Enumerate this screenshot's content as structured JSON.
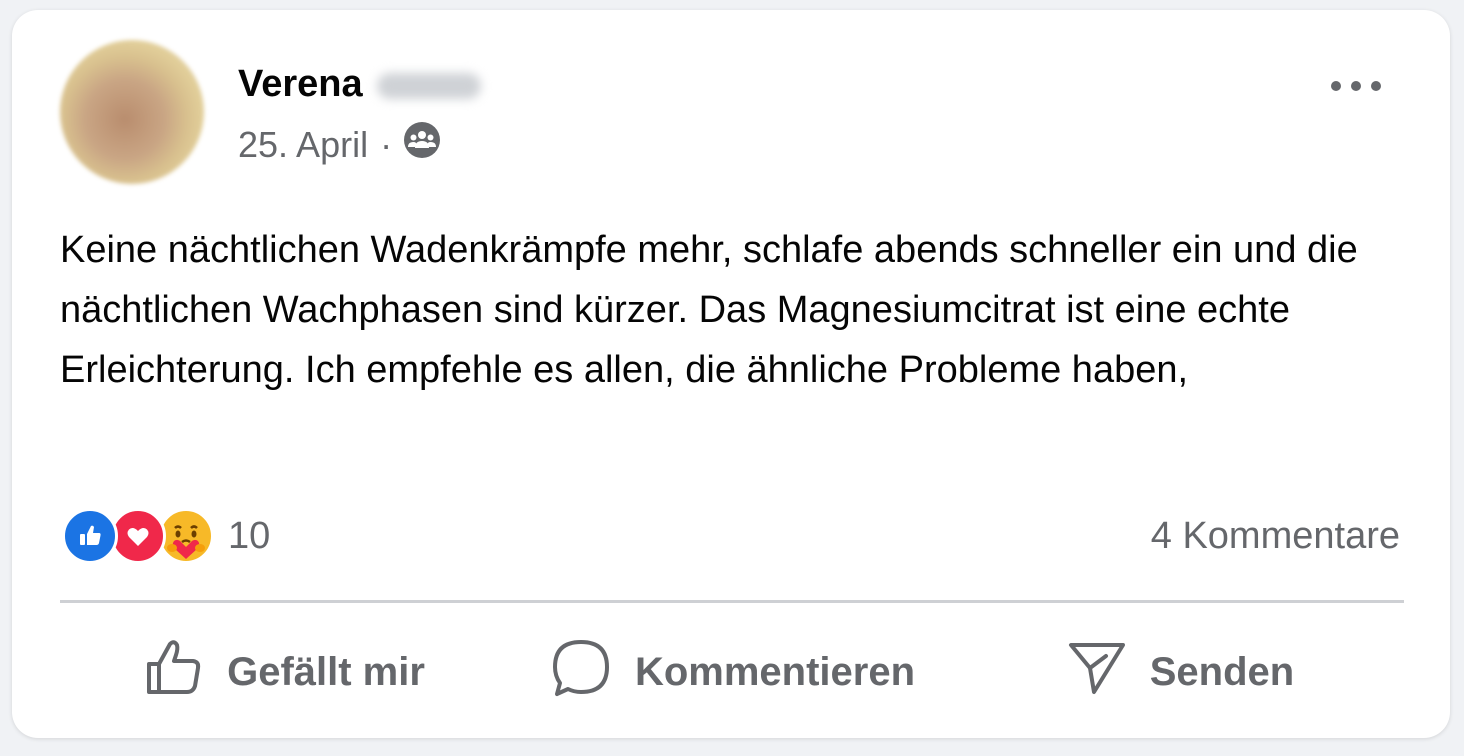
{
  "post": {
    "author_first_name": "Verena",
    "date": "25. April",
    "separator": "·",
    "audience_icon": "group-icon",
    "text": "Keine nächtlichen Wadenkrämpfe mehr, schlafe abends schneller ein und die nächtlichen Wachphasen sind kürzer. Das Magnesiumcitrat ist eine echte Erleichterung. Ich empfehle es allen, die ähnliche Probleme haben,"
  },
  "reactions": {
    "types": [
      "like",
      "love",
      "care"
    ],
    "count": "10"
  },
  "comments": {
    "label": "4 Kommentare"
  },
  "actions": {
    "like_label": "Gefällt mir",
    "comment_label": "Kommentieren",
    "send_label": "Senden"
  },
  "colors": {
    "like_blue": "#1b74e4",
    "love_red": "#f0284a",
    "care_yellow": "#f7b928",
    "secondary_text": "#65676b",
    "primary_text": "#050505"
  }
}
